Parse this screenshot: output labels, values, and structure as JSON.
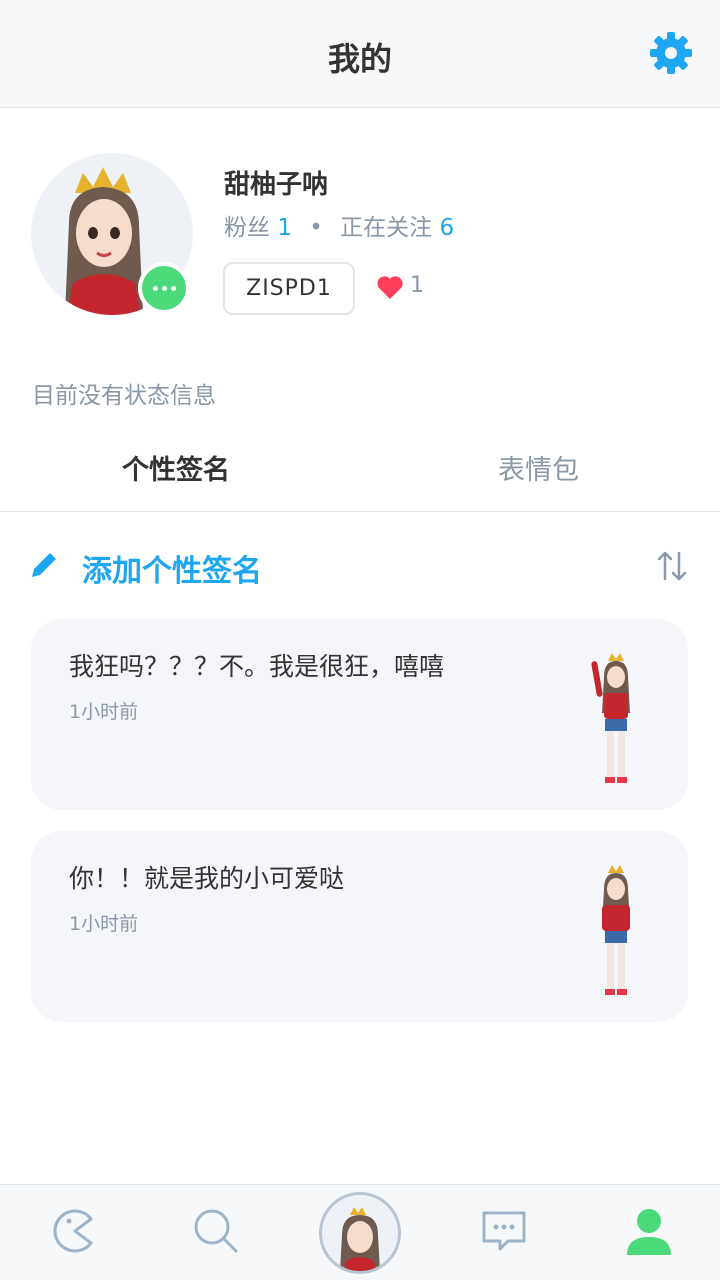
{
  "header": {
    "title": "我的",
    "settings_icon": "gear-icon"
  },
  "profile": {
    "username": "甜柚子呐",
    "fans_label": "粉丝",
    "fans_count": "1",
    "separator": "•",
    "following_label": "正在关注",
    "following_count": "6",
    "user_id": "ZISPD1",
    "likes_count": "1",
    "status_text": "目前没有状态信息"
  },
  "tabs": [
    {
      "label": "个性签名",
      "active": true
    },
    {
      "label": "表情包",
      "active": false
    }
  ],
  "signature_section": {
    "add_label": "添加个性签名"
  },
  "cards": [
    {
      "text": "我狂吗？？？不。我是很狂，嘻嘻",
      "time": "1小时前"
    },
    {
      "text": "你！！就是我的小可爱哒",
      "time": "1小时前"
    }
  ],
  "bottom_nav": [
    {
      "icon": "pacman-icon"
    },
    {
      "icon": "search-icon"
    },
    {
      "icon": "avatar-icon"
    },
    {
      "icon": "chat-icon"
    },
    {
      "icon": "profile-icon",
      "active": true
    }
  ],
  "colors": {
    "accent": "#1ea7f0",
    "green": "#4cd97a",
    "heart": "#ff3d5c",
    "muted": "#8a97a7"
  }
}
